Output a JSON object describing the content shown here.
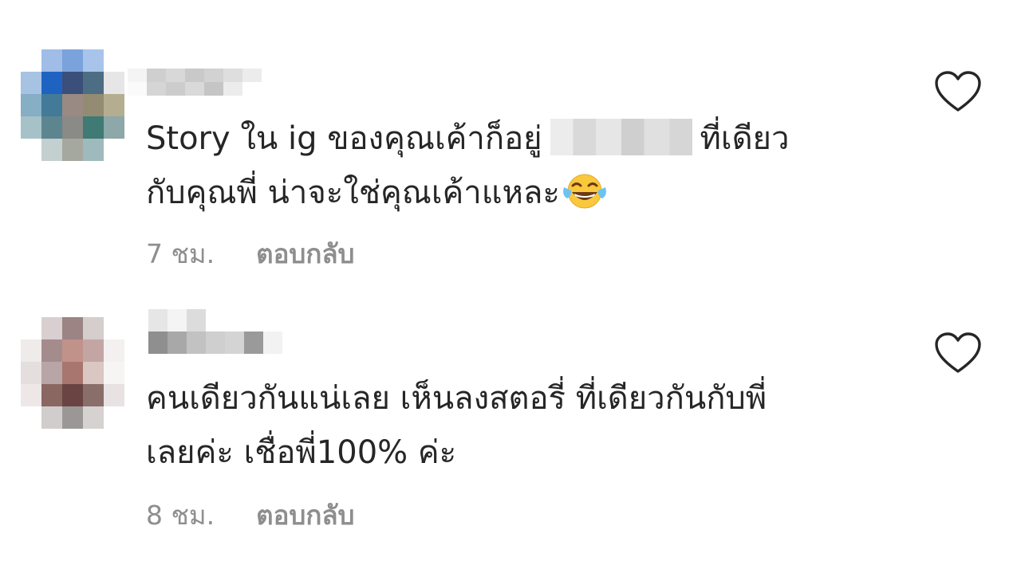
{
  "comments": [
    {
      "text_line1_before": "Story ใน ig ของคุณเค้าก็อยู่",
      "text_line1_after": "ที่เดียว",
      "text_line2": "กับคุณพี่ น่าจะใช่คุณเค้าแหละ",
      "emoji": "face-with-tears-of-joy-emoji",
      "time": "7 ชม.",
      "reply_label": "ตอบกลับ"
    },
    {
      "text_line1": "คนเดียวกันแน่เลย เห็นลงสตอรี่ ที่เดียวกันกับพี่",
      "text_line2": "เลยค่ะ เชื่อพี่100% ค่ะ",
      "time": "8 ชม.",
      "reply_label": "ตอบกลับ"
    }
  ],
  "icons": {
    "like": "heart-outline-icon"
  },
  "colors": {
    "text": "#262626",
    "secondary": "#8e8e8e",
    "background": "#ffffff"
  }
}
